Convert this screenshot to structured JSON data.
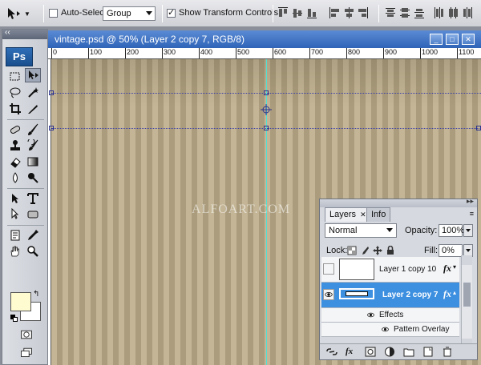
{
  "options_bar": {
    "auto_select_label": "Auto-Select:",
    "auto_select_checked": false,
    "auto_select_value": "Group",
    "show_transform_label": "Show Transform Controls",
    "show_transform_checked": true,
    "align_icons": [
      "align-top-edges-icon",
      "align-vertical-centers-icon",
      "align-bottom-edges-icon",
      "align-left-edges-icon",
      "align-horizontal-centers-icon",
      "align-right-edges-icon",
      "distribute-top-icon",
      "distribute-vertical-centers-icon",
      "distribute-bottom-icon",
      "distribute-left-icon",
      "distribute-horizontal-centers-icon",
      "distribute-right-icon"
    ]
  },
  "toolbox": {
    "logo": "Ps",
    "foreground_color": "#fffbd0",
    "background_color": "#ffffff"
  },
  "document": {
    "title": "vintage.psd @ 50% (Layer 2 copy 7, RGB/8)",
    "ruler_labels": [
      "0",
      "100",
      "200",
      "300",
      "400",
      "500",
      "600",
      "700",
      "800",
      "900",
      "1000",
      "1100"
    ],
    "watermark": "ALFOART.COM"
  },
  "layers_panel": {
    "tabs": [
      "Layers",
      "Info"
    ],
    "active_tab": "Layers",
    "blend_mode": "Normal",
    "opacity_label": "Opacity:",
    "opacity_value": "100%",
    "lock_label": "Lock:",
    "fill_label": "Fill:",
    "fill_value": "0%",
    "layers": [
      {
        "name": "Layer 1 copy 10",
        "visible": false,
        "selected": false,
        "has_fx": true
      },
      {
        "name": "Layer 2 copy 7",
        "visible": true,
        "selected": true,
        "has_fx": true
      }
    ],
    "effects_label": "Effects",
    "effect_items": [
      "Pattern Overlay"
    ]
  }
}
